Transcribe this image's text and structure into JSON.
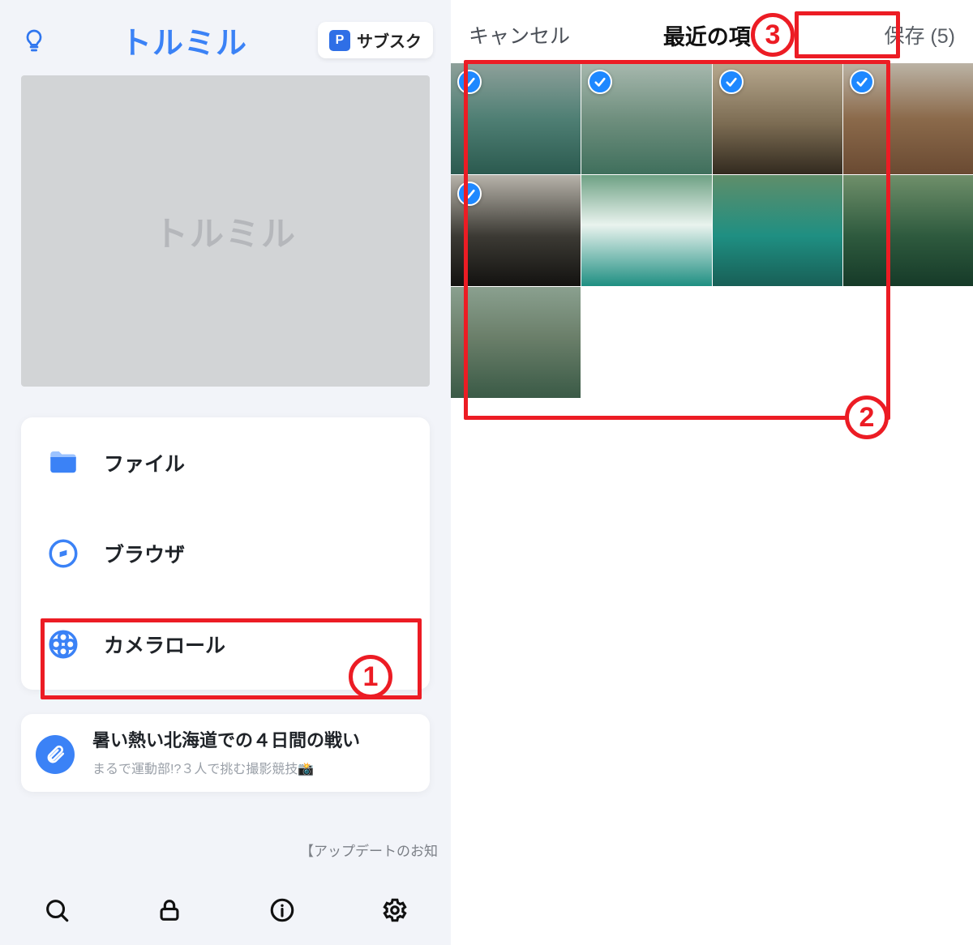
{
  "left": {
    "app_title": "トルミル",
    "subscribe_label": "サブスク",
    "subscribe_badge": "P",
    "hero_text": "トルミル",
    "menu": {
      "items": [
        {
          "label": "ファイル"
        },
        {
          "label": "ブラウザ"
        },
        {
          "label": "カメラロール"
        }
      ]
    },
    "news": {
      "title": "暑い熱い北海道での４日間の戦い",
      "subtitle": "まるで運動部!?３人で挑む撮影競技📸"
    },
    "update_note": "【アップデートのお知"
  },
  "right": {
    "cancel": "キャンセル",
    "title": "最近の項目",
    "save": "保存 (5)",
    "photos": [
      {
        "selected": true
      },
      {
        "selected": true
      },
      {
        "selected": true
      },
      {
        "selected": true
      },
      {
        "selected": true
      },
      {
        "selected": false
      },
      {
        "selected": false
      },
      {
        "selected": false
      },
      {
        "selected": false
      }
    ]
  },
  "annotations": {
    "a1": "1",
    "a2": "2",
    "a3": "3"
  }
}
